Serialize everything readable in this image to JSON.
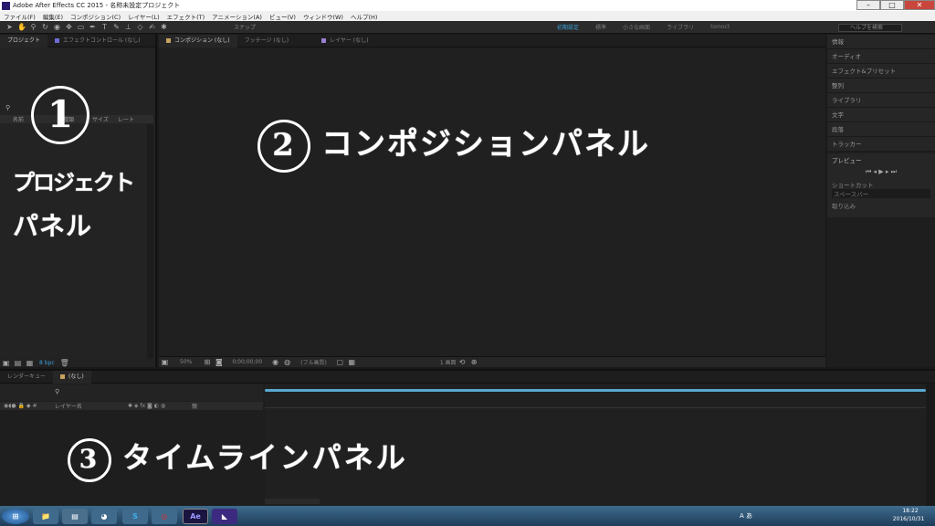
{
  "window": {
    "title": "Adobe After Effects CC 2015 - 名称未設定プロジェクト",
    "minimize": "–",
    "maximize": "□",
    "close": "✕"
  },
  "menu": [
    "ファイル(F)",
    "編集(E)",
    "コンポジション(C)",
    "レイヤー(L)",
    "エフェクト(T)",
    "アニメーション(A)",
    "ビュー(V)",
    "ウィンドウ(W)",
    "ヘルプ(H)"
  ],
  "toolbar": {
    "snap_label": "スナップ",
    "workspaces": [
      "初期設定",
      "標準",
      "小さな画面",
      "ライブラリ",
      "tomoct"
    ],
    "active_workspace": 0,
    "help_search": "ヘルプを検索"
  },
  "project_panel": {
    "tabs": [
      "プロジェクト",
      "エフェクトコントロール (なし)"
    ],
    "columns": [
      "名前",
      "種類",
      "サイズ",
      "レート"
    ],
    "bpc": "8 bpc"
  },
  "comp_panel": {
    "tabs": [
      "コンポジション (なし)",
      "フッテージ (なし)",
      "レイヤー (なし)"
    ],
    "zoom": "50%",
    "timecode": "0;00;00;00",
    "resolution": "(フル画質)",
    "view": "1 画面"
  },
  "right_panel": {
    "items": [
      "情報",
      "オーディオ",
      "エフェクト&プリセット",
      "整列",
      "ライブラリ",
      "文字",
      "段落",
      "トラッカー"
    ],
    "preview_title": "プレビュー",
    "shortcut_label": "ショートカット",
    "shortcut_value": "スペースバー",
    "include_label": "取り込み"
  },
  "timeline": {
    "tabs": [
      "レンダーキュー",
      "(なし)"
    ],
    "layer_name_header": "レイヤー名",
    "parent_header": "親"
  },
  "annotations": {
    "project_num": "1",
    "project_line1": "プロジェクト",
    "project_line2": "パネル",
    "comp_num": "2",
    "comp_text": "コンポジションパネル",
    "timeline_num": "3",
    "timeline_text": "タイムラインパネル"
  },
  "taskbar": {
    "time": "18:22",
    "date": "2016/10/31",
    "ime": "A あ"
  }
}
